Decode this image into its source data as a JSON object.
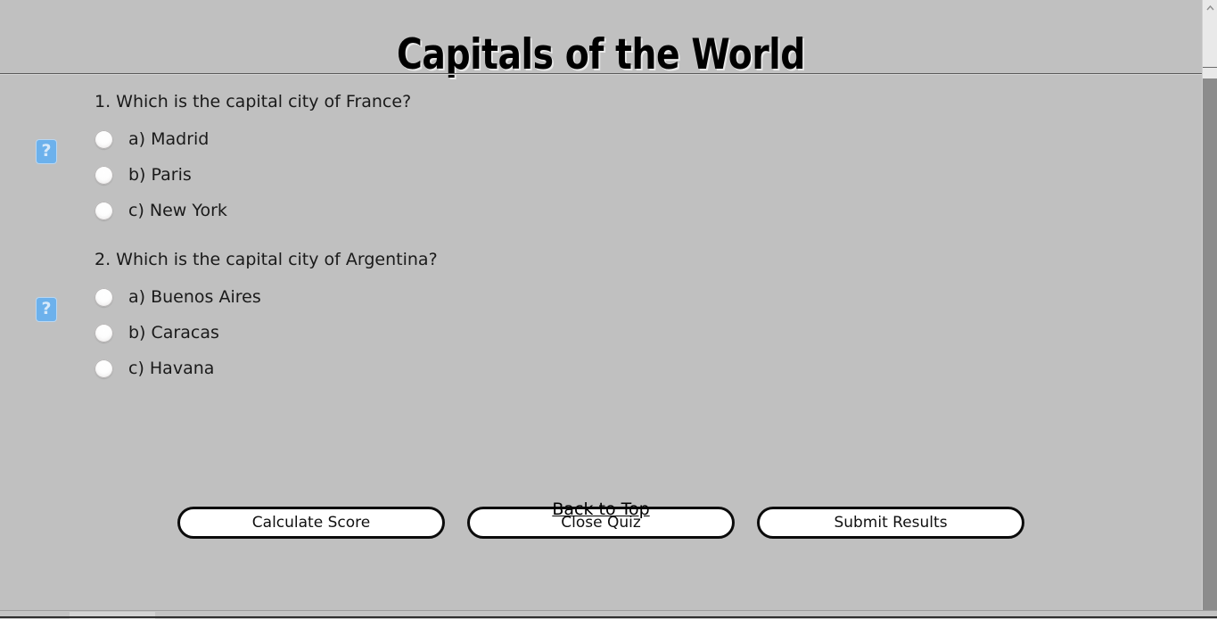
{
  "header": {
    "title": "Capitals of the World"
  },
  "quiz": {
    "questions": [
      {
        "number": "1.",
        "text": "1. Which is the capital city of France?",
        "image_alt_icon": "broken-image-icon",
        "options": [
          {
            "label": "a) Madrid",
            "selected": false
          },
          {
            "label": "b) Paris",
            "selected": false
          },
          {
            "label": "c) New York",
            "selected": false
          }
        ]
      },
      {
        "number": "2.",
        "text": "2. Which is the capital city of Argentina?",
        "image_alt_icon": "broken-image-icon",
        "options": [
          {
            "label": "a) Buenos Aires",
            "selected": false
          },
          {
            "label": "b) Caracas",
            "selected": false
          },
          {
            "label": "c) Havana",
            "selected": false
          }
        ]
      }
    ]
  },
  "buttons": {
    "calculate": "Calculate Score",
    "close": "Close Quiz",
    "submit": "Submit Results"
  },
  "footer": {
    "back_to_top": "Back to Top"
  },
  "scrollbars": {
    "vertical": {
      "up_arrow_icon": "chevron-up-icon",
      "down_arrow_icon": "chevron-down-icon"
    },
    "horizontal": {
      "present": true
    }
  },
  "colors": {
    "page_background": "#c0c0c0",
    "text": "#1a1a1a",
    "button_border": "#0b0b0b",
    "button_fill": "#ffffff",
    "broken_image": "#6cb1ec",
    "scrollbar_thumb": "#8c8c8c"
  }
}
